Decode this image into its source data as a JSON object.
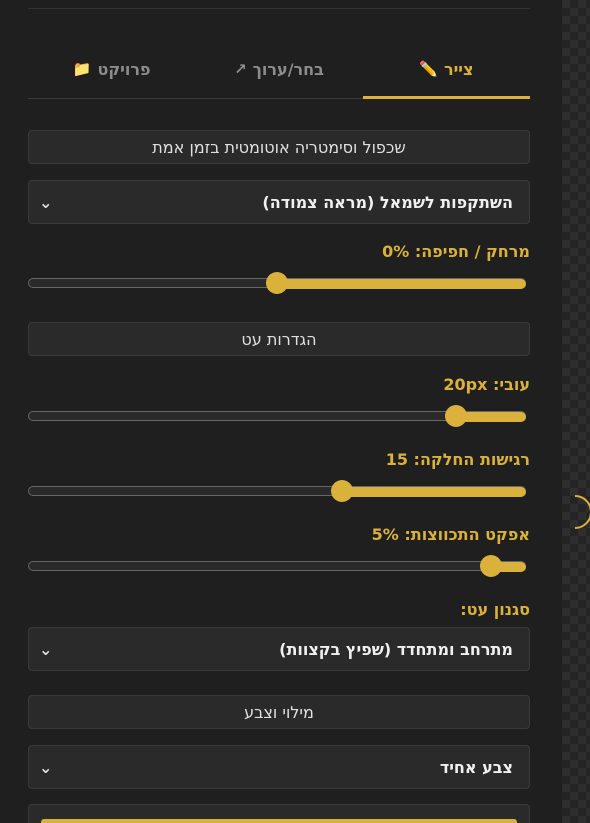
{
  "tabs": [
    {
      "label": "צייר",
      "icon": "pencil-icon",
      "glyph": "✏️",
      "active": true
    },
    {
      "label": "בחר/ערוך",
      "icon": "arrow-icon",
      "glyph": "↗",
      "active": false
    },
    {
      "label": "פרויקט",
      "icon": "folder-icon",
      "glyph": "📁",
      "active": false
    }
  ],
  "symmetry_button": "שכפול וסימטריה אוטומטית בזמן אמת",
  "symmetry_select": {
    "value": "השתקפות לשמאל (מראה צמודה)"
  },
  "distance": {
    "label": "מרחק / חפיפה: 0%",
    "fraction": 0.5
  },
  "pen_settings_button": "הגדרות עט",
  "thickness": {
    "label": "עובי: 20px",
    "fraction": 0.14
  },
  "smoothing": {
    "label": "רגישות החלקה: 15",
    "fraction": 0.37
  },
  "taper": {
    "label": "אפקט התכווצות: 5%",
    "fraction": 0.07
  },
  "pen_style": {
    "label": "סגנון עט:",
    "value": "מתרחב ומתחדד (שפיץ בקצוות)"
  },
  "fill_color_button": "מילוי וצבע",
  "fill_select": {
    "value": "צבע אחיד"
  },
  "colors": {
    "accent": "#d9b13b",
    "background": "#1f1f1f",
    "control": "#2a2a2a"
  }
}
